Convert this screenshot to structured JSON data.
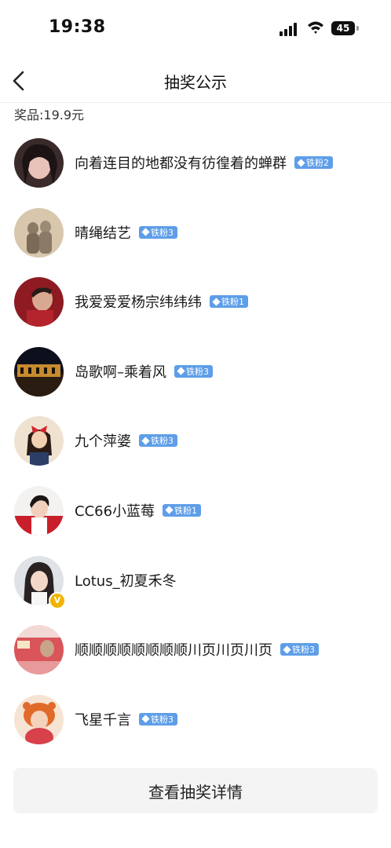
{
  "status_bar": {
    "time": "19:38",
    "battery": "45"
  },
  "nav": {
    "title": "抽奖公示",
    "back_icon": "chevron-left-icon"
  },
  "prize": {
    "text": "奖品:19.9元"
  },
  "winners": [
    {
      "name": "向着连目的地都没有彷徨着的蝉群",
      "badge": "铁粉2",
      "verified": false
    },
    {
      "name": "晴绳结艺",
      "badge": "铁粉3",
      "verified": false
    },
    {
      "name": "我爱爱爱杨宗纬纬纬",
      "badge": "铁粉1",
      "verified": false
    },
    {
      "name": "岛歌啊–乘着风",
      "badge": "铁粉3",
      "verified": false
    },
    {
      "name": "九个萍婆",
      "badge": "铁粉3",
      "verified": false
    },
    {
      "name": "CC66小蓝莓",
      "badge": "铁粉1",
      "verified": false
    },
    {
      "name": "Lotus_初夏禾冬",
      "badge": "",
      "verified": true
    },
    {
      "name": "顺顺顺顺顺顺顺顺川页川页川页",
      "badge": "铁粉3",
      "verified": false
    },
    {
      "name": "飞星千言",
      "badge": "铁粉3",
      "verified": false
    }
  ],
  "detail_button": {
    "label": "查看抽奖详情"
  },
  "colors": {
    "badge": "#5e9ee8",
    "verified": "#f3b300",
    "button_bg": "#f4f4f4"
  }
}
